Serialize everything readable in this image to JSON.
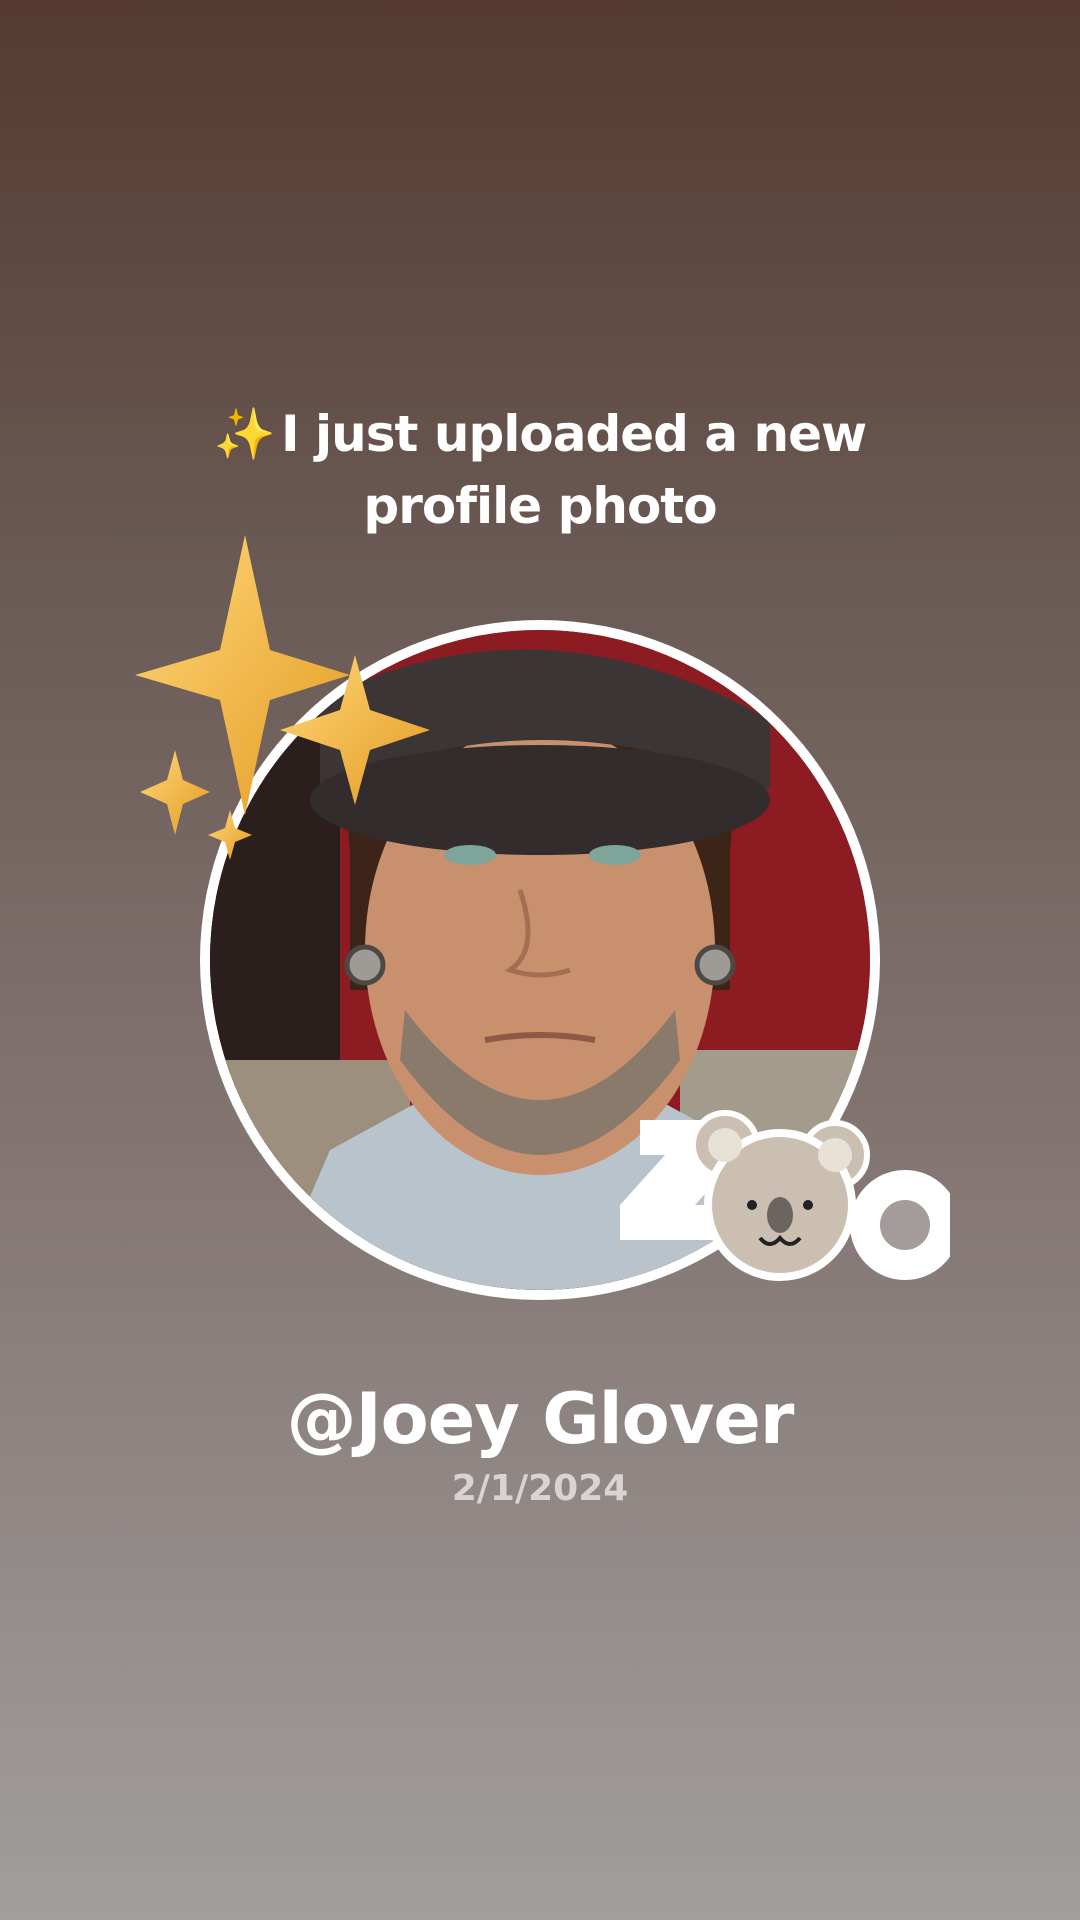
{
  "post": {
    "sparkle_icon": "✨",
    "headline_line1": "I just uploaded a new",
    "headline_line2": "profile photo",
    "username": "@Joey Glover",
    "date": "2/1/2024"
  },
  "stickers": {
    "zoo_text": "ZOO",
    "zoo_mascot": "koala-icon",
    "stars": "sparkle-stars-icon"
  },
  "colors": {
    "background_top": "#553a2f",
    "background_bottom": "#a19e9d",
    "text": "#ffffff",
    "date_text": "#d9d4d2",
    "star_gold": "#f2b23a"
  }
}
